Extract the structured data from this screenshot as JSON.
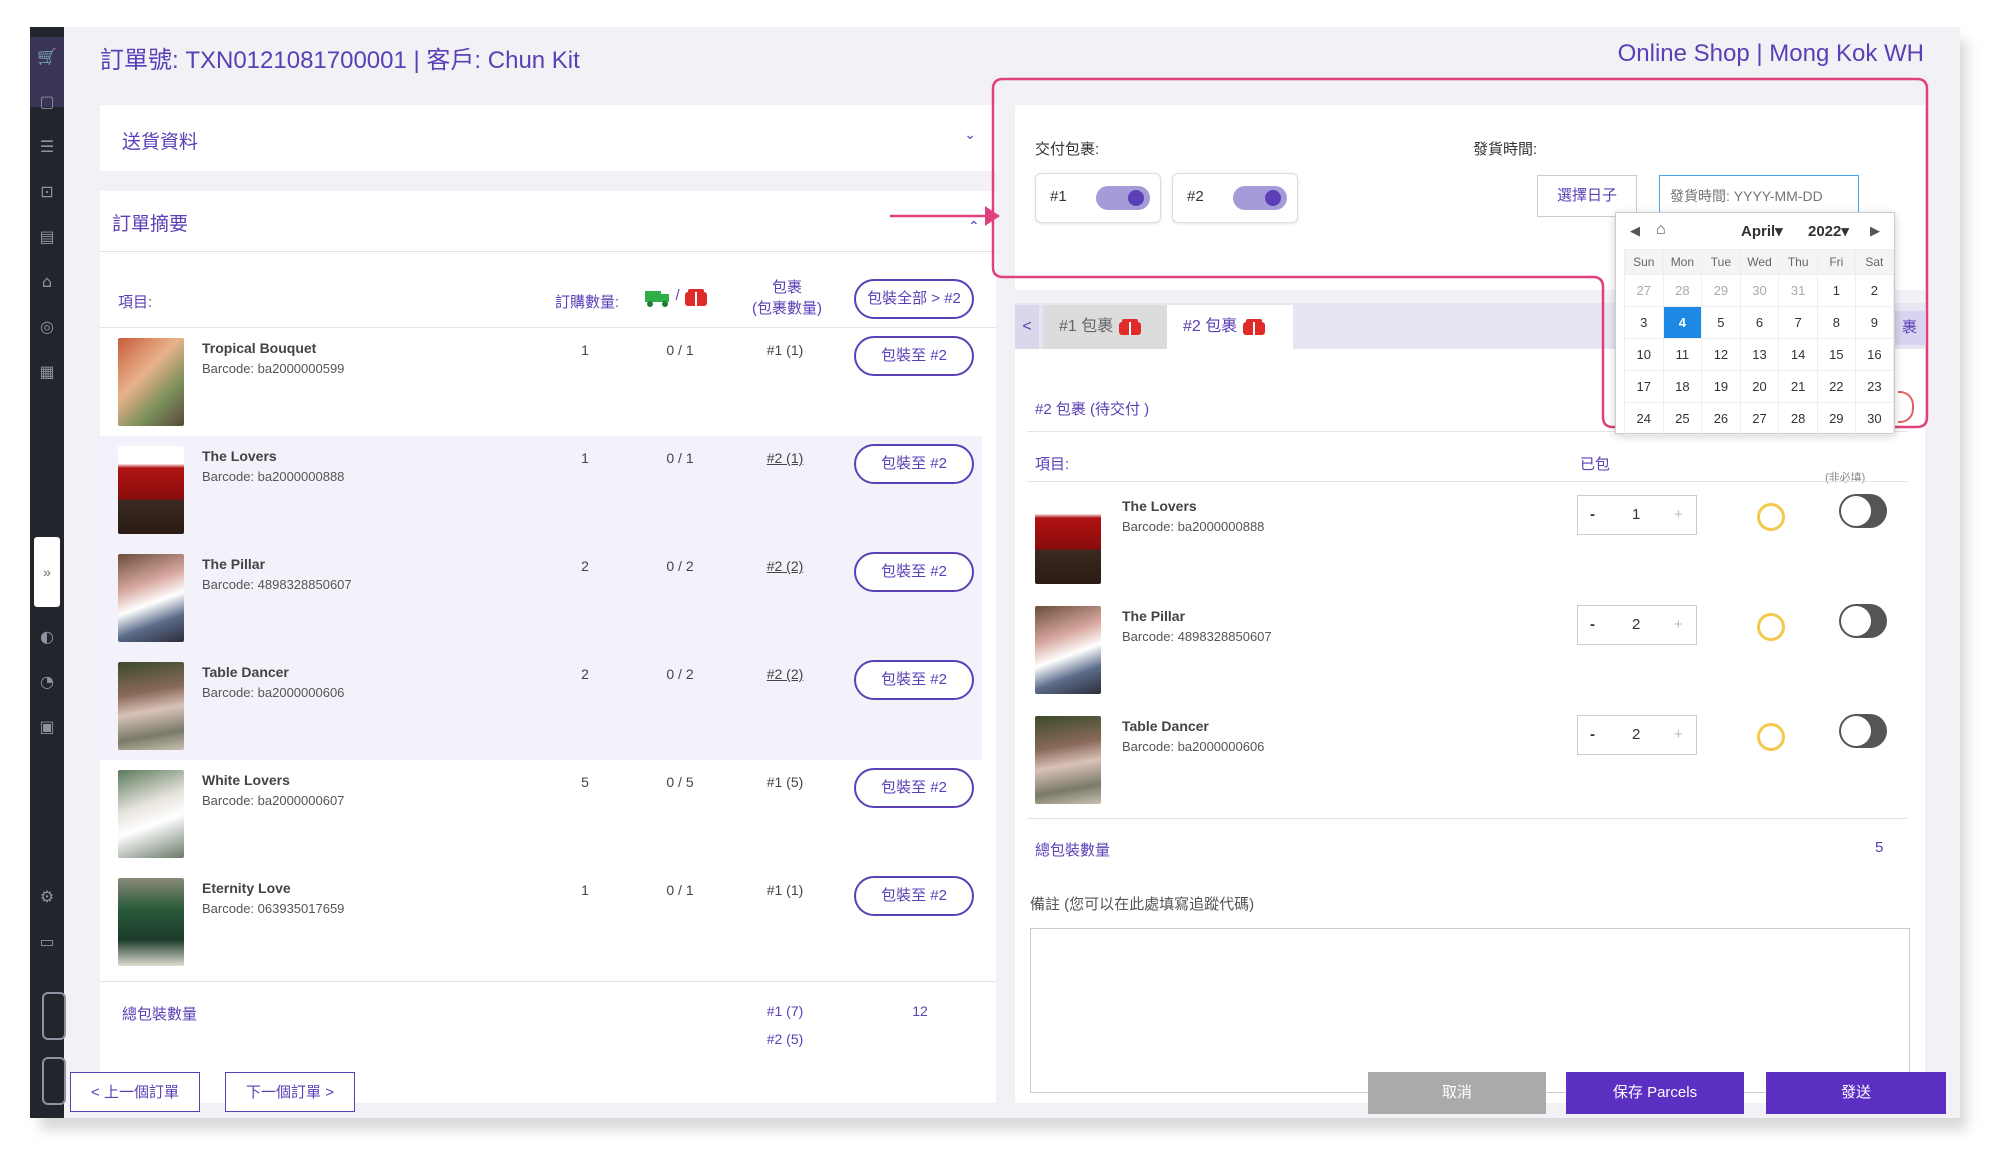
{
  "header": {
    "title": "訂單號: TXN0121081700001  |  客戶: Chun Kit",
    "right": "Online Shop  |  Mong Kok WH"
  },
  "delivery_section": {
    "title": "送貨資料"
  },
  "summary_section": {
    "title": "訂單摘要",
    "col_item": "項目:",
    "col_ordered": "訂購數量:",
    "col_ship_sep": "/",
    "col_parcel_line1": "包裹",
    "col_parcel_line2": "(包裹數量)",
    "pack_all_button": "包裝全部 > #2",
    "rows": [
      {
        "name": "Tropical Bouquet",
        "barcode": "Barcode: ba2000000599",
        "qty": "1",
        "shipped": "0 / 1",
        "parcel": "#1 (1)",
        "action": "包裝至 #2"
      },
      {
        "name": "The Lovers",
        "barcode": "Barcode: ba2000000888",
        "qty": "1",
        "shipped": "0 / 1",
        "parcel": "#2 (1)",
        "action": "包裝至 #2"
      },
      {
        "name": "The Pillar",
        "barcode": "Barcode: 4898328850607",
        "qty": "2",
        "shipped": "0 / 2",
        "parcel": "#2 (2)",
        "action": "包裝至 #2"
      },
      {
        "name": "Table Dancer",
        "barcode": "Barcode: ba2000000606",
        "qty": "2",
        "shipped": "0 / 2",
        "parcel": "#2 (2)",
        "action": "包裝至 #2"
      },
      {
        "name": "White Lovers",
        "barcode": "Barcode: ba2000000607",
        "qty": "5",
        "shipped": "0 / 5",
        "parcel": "#1 (5)",
        "action": "包裝至 #2"
      },
      {
        "name": "Eternity Love",
        "barcode": "Barcode: 063935017659",
        "qty": "1",
        "shipped": "0 / 1",
        "parcel": "#1 (1)",
        "action": "包裝至 #2"
      }
    ],
    "total_label": "總包裝數量",
    "total_parcel_1": "#1 (7)",
    "total_parcel_2": "#2 (5)",
    "total_value": "12"
  },
  "right_panel": {
    "deliver_label": "交付包裹:",
    "toggle1": "#1",
    "toggle2": "#2",
    "ship_time_label": "發貨時間:",
    "choose_date_button": "選擇日子",
    "date_placeholder": "發貨時間: YYYY-MM-DD",
    "tab1": "#1 包裹",
    "tab2": "#2 包裹",
    "tab_back": "<",
    "parcel_status": "#2 包裹 (待交付 )",
    "items_label": "項目:",
    "packed_partial": "已包",
    "optional_hint": "(非必填)",
    "tab_overflow": "裹",
    "items": [
      {
        "name": "The Lovers",
        "barcode": "Barcode: ba2000000888",
        "qty": "1"
      },
      {
        "name": "The Pillar",
        "barcode": "Barcode: 4898328850607",
        "qty": "2"
      },
      {
        "name": "Table Dancer",
        "barcode": "Barcode: ba2000000606",
        "qty": "2"
      }
    ],
    "total_label": "總包裝數量",
    "total_value": "5",
    "remark_label": "備註 (您可以在此處填寫追蹤代碼)"
  },
  "calendar": {
    "month": "April",
    "year": "2022",
    "days_header": [
      "Sun",
      "Mon",
      "Tue",
      "Wed",
      "Thu",
      "Fri",
      "Sat"
    ],
    "weeks": [
      [
        "27",
        "28",
        "29",
        "30",
        "31",
        "1",
        "2"
      ],
      [
        "3",
        "4",
        "5",
        "6",
        "7",
        "8",
        "9"
      ],
      [
        "10",
        "11",
        "12",
        "13",
        "14",
        "15",
        "16"
      ],
      [
        "17",
        "18",
        "19",
        "20",
        "21",
        "22",
        "23"
      ],
      [
        "24",
        "25",
        "26",
        "27",
        "28",
        "29",
        "30"
      ]
    ],
    "selected": "4"
  },
  "footer": {
    "prev": "< 上一個訂單",
    "next": "下一個訂單 >",
    "cancel": "取消",
    "save": "保存 Parcels",
    "send": "發送"
  },
  "colors": {
    "accent": "#5a3fb6",
    "highlight": "#e0407e",
    "sidebar": "#22252c",
    "cancel_bg": "#aaaaaa"
  }
}
